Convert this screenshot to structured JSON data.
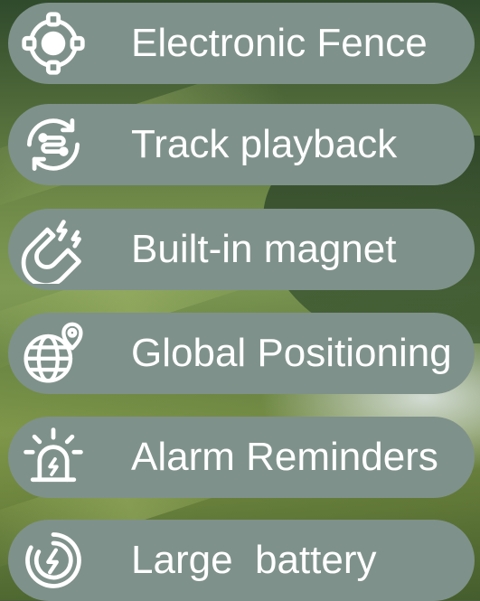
{
  "features": [
    {
      "label": "Electronic Fence",
      "icon": "target-fence-icon"
    },
    {
      "label": "Track playback",
      "icon": "track-playback-icon"
    },
    {
      "label": "Built-in magnet",
      "icon": "magnet-icon"
    },
    {
      "label": "Global Positioning",
      "icon": "globe-location-icon"
    },
    {
      "label": "Alarm Reminders",
      "icon": "alarm-light-icon"
    },
    {
      "label": "Large  battery",
      "icon": "battery-charge-icon"
    }
  ],
  "colors": {
    "pill": "#7f918b",
    "text": "#ffffff",
    "icon": "#ffffff"
  }
}
